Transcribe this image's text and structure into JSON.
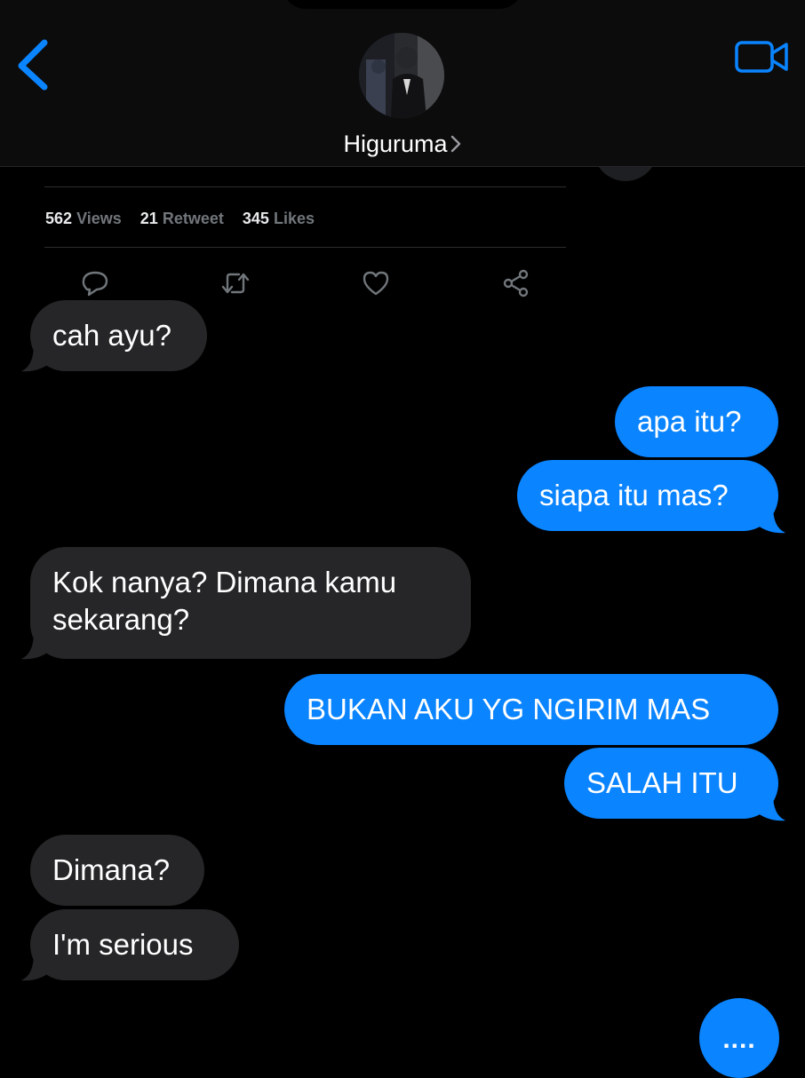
{
  "header": {
    "contact_name": "Higuruma",
    "back_icon": "chevron-left-icon",
    "video_icon": "video-camera-icon",
    "accent": "#0a84ff"
  },
  "tweet": {
    "views_count": "562",
    "views_label": "Views",
    "retweets_count": "21",
    "retweets_label": "Retweet",
    "likes_count": "345",
    "likes_label": "Likes",
    "actions": [
      "reply-icon",
      "retweet-icon",
      "like-icon",
      "share-icon"
    ]
  },
  "messages": [
    {
      "from": "them",
      "text": "cah ayu?"
    },
    {
      "from": "me",
      "text": "apa itu?"
    },
    {
      "from": "me",
      "text": "siapa itu mas?"
    },
    {
      "from": "them",
      "line1": "Kok nanya? Dimana kamu",
      "line2": "sekarang?"
    },
    {
      "from": "me",
      "text": "BUKAN AKU YG NGIRIM MAS"
    },
    {
      "from": "me",
      "text": "SALAH ITU"
    },
    {
      "from": "them",
      "text": "Dimana?"
    },
    {
      "from": "them",
      "text": "I'm serious"
    }
  ],
  "typing_indicator": "....",
  "colors": {
    "incoming_bubble": "#262628",
    "outgoing_bubble": "#0a84ff",
    "background": "#000000"
  }
}
